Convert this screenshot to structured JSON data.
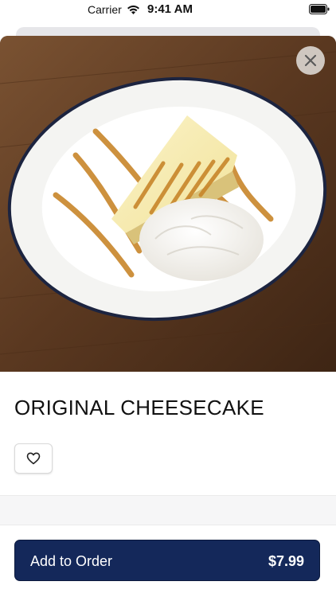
{
  "status_bar": {
    "carrier": "Carrier",
    "time": "9:41 AM"
  },
  "item": {
    "name": "ORIGINAL CHEESECAKE",
    "image_alt": "Slice of cheesecake with caramel drizzle and whipped cream on a white plate"
  },
  "actions": {
    "close_icon": "close-icon",
    "favorite_icon": "heart-outline-icon",
    "add_label": "Add to Order",
    "price": "$7.99"
  },
  "colors": {
    "accent": "#14285a",
    "button_text": "#ffffff"
  }
}
